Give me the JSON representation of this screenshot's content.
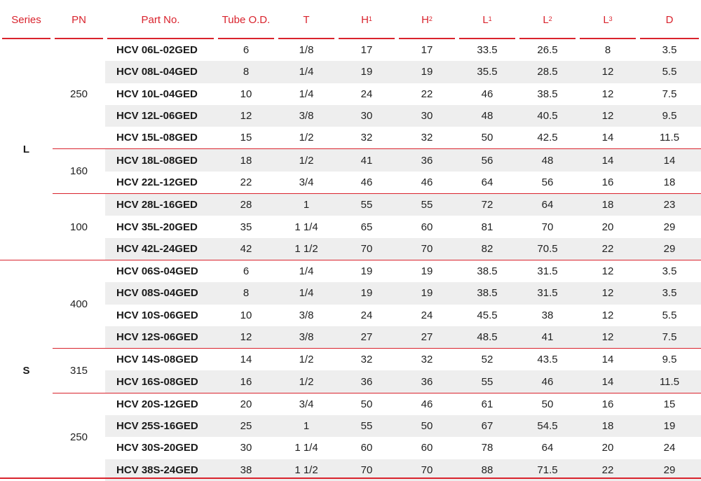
{
  "colors": {
    "accent": "#d9232d",
    "row_shade": "#eeeeee"
  },
  "headers": [
    {
      "main": "Series",
      "sub": ""
    },
    {
      "main": "PN",
      "sub": ""
    },
    {
      "main": "Part No.",
      "sub": ""
    },
    {
      "main": "Tube O.D.",
      "sub": ""
    },
    {
      "main": "T",
      "sub": ""
    },
    {
      "main": "H",
      "sub": "1"
    },
    {
      "main": "H",
      "sub": "2"
    },
    {
      "main": "L",
      "sub": "1"
    },
    {
      "main": "L",
      "sub": "2"
    },
    {
      "main": "L",
      "sub": "3"
    },
    {
      "main": "D",
      "sub": ""
    }
  ],
  "series": [
    {
      "name": "L",
      "groups": [
        {
          "pn": "250",
          "rows": [
            [
              "HCV 06L-02GED",
              "6",
              "1/8",
              "17",
              "17",
              "33.5",
              "26.5",
              "8",
              "3.5"
            ],
            [
              "HCV 08L-04GED",
              "8",
              "1/4",
              "19",
              "19",
              "35.5",
              "28.5",
              "12",
              "5.5"
            ],
            [
              "HCV 10L-04GED",
              "10",
              "1/4",
              "24",
              "22",
              "46",
              "38.5",
              "12",
              "7.5"
            ],
            [
              "HCV 12L-06GED",
              "12",
              "3/8",
              "30",
              "30",
              "48",
              "40.5",
              "12",
              "9.5"
            ],
            [
              "HCV 15L-08GED",
              "15",
              "1/2",
              "32",
              "32",
              "50",
              "42.5",
              "14",
              "11.5"
            ]
          ]
        },
        {
          "pn": "160",
          "rows": [
            [
              "HCV 18L-08GED",
              "18",
              "1/2",
              "41",
              "36",
              "56",
              "48",
              "14",
              "14"
            ],
            [
              "HCV 22L-12GED",
              "22",
              "3/4",
              "46",
              "46",
              "64",
              "56",
              "16",
              "18"
            ]
          ]
        },
        {
          "pn": "100",
          "rows": [
            [
              "HCV 28L-16GED",
              "28",
              "1",
              "55",
              "55",
              "72",
              "64",
              "18",
              "23"
            ],
            [
              "HCV 35L-20GED",
              "35",
              "1 1/4",
              "65",
              "60",
              "81",
              "70",
              "20",
              "29"
            ],
            [
              "HCV 42L-24GED",
              "42",
              "1 1/2",
              "70",
              "70",
              "82",
              "70.5",
              "22",
              "29"
            ]
          ]
        }
      ]
    },
    {
      "name": "S",
      "groups": [
        {
          "pn": "400",
          "rows": [
            [
              "HCV 06S-04GED",
              "6",
              "1/4",
              "19",
              "19",
              "38.5",
              "31.5",
              "12",
              "3.5"
            ],
            [
              "HCV 08S-04GED",
              "8",
              "1/4",
              "19",
              "19",
              "38.5",
              "31.5",
              "12",
              "3.5"
            ],
            [
              "HCV 10S-06GED",
              "10",
              "3/8",
              "24",
              "24",
              "45.5",
              "38",
              "12",
              "5.5"
            ],
            [
              "HCV 12S-06GED",
              "12",
              "3/8",
              "27",
              "27",
              "48.5",
              "41",
              "12",
              "7.5"
            ]
          ]
        },
        {
          "pn": "315",
          "rows": [
            [
              "HCV 14S-08GED",
              "14",
              "1/2",
              "32",
              "32",
              "52",
              "43.5",
              "14",
              "9.5"
            ],
            [
              "HCV 16S-08GED",
              "16",
              "1/2",
              "36",
              "36",
              "55",
              "46",
              "14",
              "11.5"
            ]
          ]
        },
        {
          "pn": "250",
          "rows": [
            [
              "HCV 20S-12GED",
              "20",
              "3/4",
              "50",
              "46",
              "61",
              "50",
              "16",
              "15"
            ],
            [
              "HCV 25S-16GED",
              "25",
              "1",
              "55",
              "50",
              "67",
              "54.5",
              "18",
              "19"
            ],
            [
              "HCV 30S-20GED",
              "30",
              "1 1/4",
              "60",
              "60",
              "78",
              "64",
              "20",
              "24"
            ],
            [
              "HCV 38S-24GED",
              "38",
              "1 1/2",
              "70",
              "70",
              "88",
              "71.5",
              "22",
              "29"
            ]
          ]
        }
      ]
    }
  ]
}
